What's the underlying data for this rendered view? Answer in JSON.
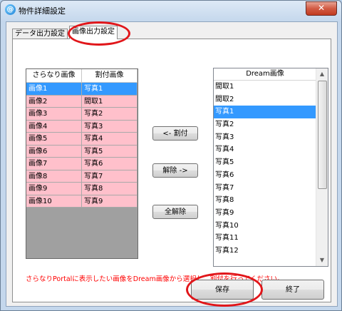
{
  "window": {
    "title": "物件詳細設定",
    "app_icon": "@",
    "close_glyph": "✕"
  },
  "tabs": [
    {
      "label": "データ出力設定",
      "selected": false
    },
    {
      "label": "画像出力設定",
      "selected": true
    }
  ],
  "grid": {
    "headers": [
      "さらなり画像",
      "割付画像"
    ],
    "rows": [
      [
        "画像1",
        "写真1"
      ],
      [
        "画像2",
        "間取1"
      ],
      [
        "画像3",
        "写真2"
      ],
      [
        "画像4",
        "写真3"
      ],
      [
        "画像5",
        "写真4"
      ],
      [
        "画像6",
        "写真5"
      ],
      [
        "画像7",
        "写真6"
      ],
      [
        "画像8",
        "写真7"
      ],
      [
        "画像9",
        "写真8"
      ],
      [
        "画像10",
        "写真9"
      ]
    ],
    "selected_row": 0
  },
  "buttons": {
    "assign": "<- 割付",
    "unassign": "解除 ->",
    "unassign_all": "全解除",
    "save": "保存",
    "close": "終了"
  },
  "dream_list": {
    "header": "Dream画像",
    "items": [
      "間取1",
      "間取2",
      "写真1",
      "写真2",
      "写真3",
      "写真4",
      "写真5",
      "写真6",
      "写真7",
      "写真8",
      "写真9",
      "写真10",
      "写真11",
      "写真12"
    ],
    "selected_index": 2
  },
  "note": "さらなりPortalに表示したい画像をDream画像から選択し、割付を行ってください。",
  "colors": {
    "assigned_row": "#ffc0cb",
    "selection": "#3399ff",
    "annotation": "#e1161a",
    "note_text": "#ff0000"
  },
  "icons": {
    "scroll_up": "scroll-up-arrow-icon",
    "scroll_down": "scroll-down-arrow-icon"
  }
}
